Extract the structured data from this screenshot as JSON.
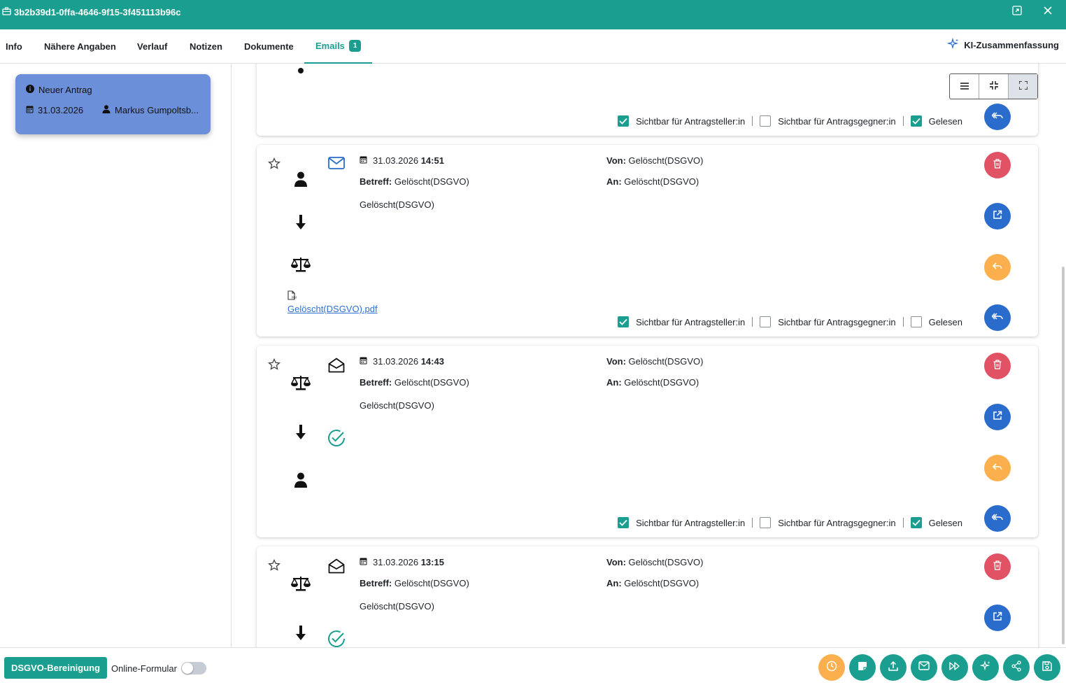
{
  "window": {
    "title": "3b2b39d1-0ffa-4646-9f15-3f451113b96c"
  },
  "tabs": [
    {
      "label": "Info"
    },
    {
      "label": "Nähere Angaben"
    },
    {
      "label": "Verlauf"
    },
    {
      "label": "Notizen"
    },
    {
      "label": "Dokumente"
    },
    {
      "label": "Emails",
      "badge": "1",
      "active": true
    }
  ],
  "ki_summary": {
    "label": "KI-Zusammenfassung"
  },
  "antrag": {
    "status": "Neuer Antrag",
    "date": "31.03.2026",
    "person": "Markus Gumpoltsb..."
  },
  "checks": {
    "antragsteller": "Sichtbar für Antragsteller:in",
    "antragsgegner": "Sichtbar für Antragsgegner:in",
    "gelesen": "Gelesen"
  },
  "labels": {
    "betreff": "Betreff:",
    "von": "Von:",
    "an": "An:"
  },
  "emails": [
    {
      "date": "31.03.2026",
      "time": "14:51",
      "subject": "Gelöscht(DSGVO)",
      "from": "Gelöscht(DSGVO)",
      "to": "Gelöscht(DSGVO)",
      "body": "Gelöscht(DSGVO)",
      "attachment": "Gelöscht(DSGVO).pdf",
      "flags": {
        "antragsteller": true,
        "antragsgegner": false,
        "gelesen": false
      }
    },
    {
      "date": "31.03.2026",
      "time": "14:43",
      "subject": "Gelöscht(DSGVO)",
      "from": "Gelöscht(DSGVO)",
      "to": "Gelöscht(DSGVO)",
      "body": "Gelöscht(DSGVO)",
      "flags": {
        "antragsteller": true,
        "antragsgegner": false,
        "gelesen": true
      }
    },
    {
      "date": "31.03.2026",
      "time": "13:15",
      "subject": "Gelöscht(DSGVO)",
      "from": "Gelöscht(DSGVO)",
      "to": "Gelöscht(DSGVO)",
      "body": "Gelöscht(DSGVO)"
    }
  ],
  "top_card_flags": {
    "antragsteller": true,
    "antragsgegner": false,
    "gelesen": true
  },
  "footer": {
    "dsgvo_button": "DSGVO-Bereinigung",
    "online_form": "Online-Formular",
    "online_form_enabled": false
  },
  "colors": {
    "accent": "#1a9e8f",
    "delete": "#e05264",
    "action": "#2a6ccc",
    "reply": "#fbb04d",
    "antrag_card": "#6b8fd8"
  }
}
